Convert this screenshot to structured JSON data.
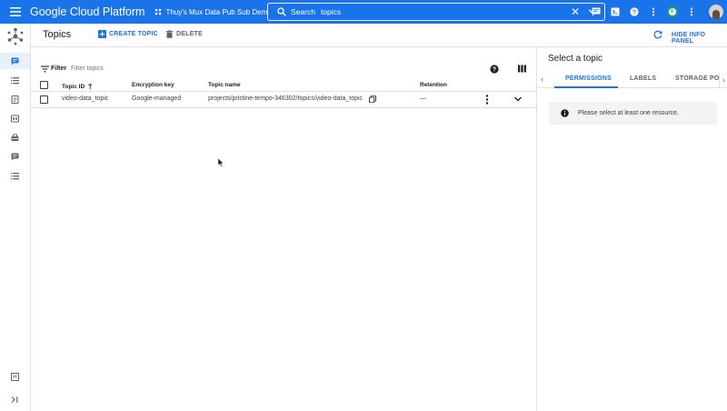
{
  "topbar": {
    "brand": "Google Cloud Platform",
    "project": "Thuy's Mux Data Pub Sub Demo",
    "search_label": "Search",
    "search_value": "topics",
    "notification_count": "6"
  },
  "page": {
    "title": "Topics",
    "create_label": "CREATE TOPIC",
    "delete_label": "DELETE",
    "hide_panel_label": "HIDE INFO PANEL"
  },
  "filter": {
    "label": "Filter",
    "placeholder": "Filter topics"
  },
  "table": {
    "headers": {
      "topic_id": "Topic ID",
      "encryption_key": "Encryption key",
      "topic_name": "Topic name",
      "retention": "Retention"
    },
    "rows": [
      {
        "topic_id": "video-data_topic",
        "encryption_key": "Google-managed",
        "topic_name": "projects/pristine-tempo-346302/topics/video-data_topic",
        "retention": "—"
      }
    ]
  },
  "panel": {
    "title": "Select a topic",
    "tabs": [
      "PERMISSIONS",
      "LABELS",
      "STORAGE POLI"
    ],
    "info_message": "Please select at least one resource."
  },
  "colors": {
    "brand_blue": "#1a73e8",
    "active_nav_bg": "#e8f0fe"
  }
}
